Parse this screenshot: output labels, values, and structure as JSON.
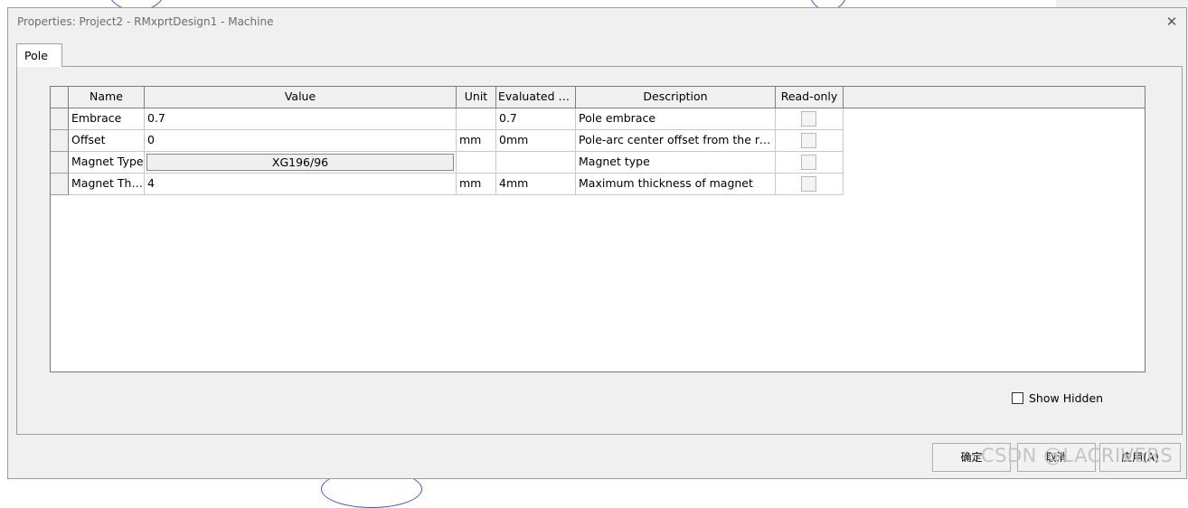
{
  "window": {
    "title": "Properties: Project2 - RMxprtDesign1 - Machine",
    "close_glyph": "✕"
  },
  "tabs": [
    {
      "label": "Pole",
      "active": true
    }
  ],
  "grid": {
    "columns": [
      "Name",
      "Value",
      "Unit",
      "Evaluated Value",
      "Description",
      "Read-only"
    ],
    "rows": [
      {
        "name": "Embrace",
        "value": "0.7",
        "unit": "",
        "evaluated": "0.7",
        "description": "Pole embrace",
        "readonly": false
      },
      {
        "name": "Offset",
        "value": "0",
        "unit": "mm",
        "evaluated": "0mm",
        "description": "Pole-arc center offset from the rotor center",
        "readonly": false
      },
      {
        "name": "Magnet Type",
        "value": "XG196/96",
        "unit": "",
        "evaluated": "",
        "description": "Magnet type",
        "readonly": false,
        "value_is_button": true
      },
      {
        "name": "Magnet Thickness",
        "value": "4",
        "unit": "mm",
        "evaluated": "4mm",
        "description": "Maximum thickness of magnet",
        "readonly": false
      }
    ]
  },
  "options": {
    "show_hidden_label": "Show Hidden",
    "show_hidden_checked": false
  },
  "buttons": {
    "ok": "确定",
    "cancel": "取消",
    "apply": "应用(A)"
  },
  "watermark": "CSDN @LACRIVERS",
  "colors": {
    "dialog_bg": "#f0f0f0",
    "grid_bg": "#ffffff",
    "header_bg": "#f0f0f0"
  }
}
